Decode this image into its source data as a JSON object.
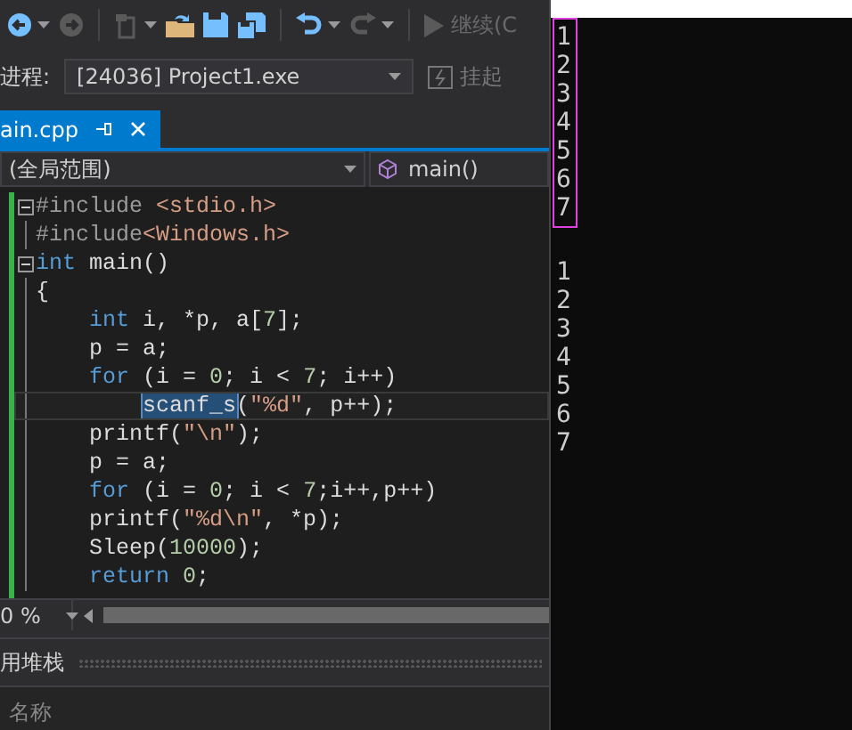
{
  "toolbar": [
    {
      "kind": "back",
      "disabled": false,
      "dropdown": true
    },
    {
      "kind": "forward",
      "disabled": true,
      "dropdown": false
    },
    {
      "kind": "new",
      "disabled": true,
      "dropdown": true
    },
    {
      "kind": "open",
      "disabled": false,
      "dropdown": false
    },
    {
      "kind": "save",
      "disabled": false,
      "dropdown": false
    },
    {
      "kind": "save-all",
      "disabled": false,
      "dropdown": false
    },
    {
      "kind": "undo",
      "disabled": false,
      "dropdown": true
    },
    {
      "kind": "redo",
      "disabled": true,
      "dropdown": true
    },
    {
      "kind": "continue",
      "disabled": true,
      "dropdown": false,
      "label": "继续(C"
    }
  ],
  "process": {
    "label": "进程:",
    "value": "[24036] Project1.exe",
    "suspend": {
      "label": "挂起",
      "disabled": true
    }
  },
  "tabs": [
    {
      "label": "ain.cpp",
      "selected": true
    }
  ],
  "navigation": {
    "scope": "(全局范围)",
    "member": "main()"
  },
  "code": [
    {
      "collapsible": true,
      "current": false,
      "tokens": [
        {
          "kind": "directive",
          "text": "#include "
        },
        {
          "kind": "string",
          "text": "<stdio.h>"
        }
      ]
    },
    {
      "collapsible": false,
      "current": false,
      "tokens": [
        {
          "kind": "directive",
          "text": "#include"
        },
        {
          "kind": "string",
          "text": "<Windows.h>"
        }
      ]
    },
    {
      "collapsible": true,
      "current": false,
      "tokens": [
        {
          "kind": "keyword",
          "text": "int"
        },
        {
          "kind": "plain",
          "text": " main()"
        }
      ]
    },
    {
      "collapsible": false,
      "current": false,
      "tokens": [
        {
          "kind": "plain",
          "text": "{"
        }
      ]
    },
    {
      "collapsible": false,
      "current": false,
      "tokens": [
        {
          "kind": "keyword",
          "text": "    int"
        },
        {
          "kind": "plain",
          "text": " i, *p, a["
        },
        {
          "kind": "number",
          "text": "7"
        },
        {
          "kind": "plain",
          "text": "];"
        }
      ]
    },
    {
      "collapsible": false,
      "current": false,
      "tokens": [
        {
          "kind": "plain",
          "text": "    p = a;"
        }
      ]
    },
    {
      "collapsible": false,
      "current": false,
      "tokens": [
        {
          "kind": "keyword",
          "text": "    for"
        },
        {
          "kind": "plain",
          "text": " (i = "
        },
        {
          "kind": "number",
          "text": "0"
        },
        {
          "kind": "plain",
          "text": "; i < "
        },
        {
          "kind": "number",
          "text": "7"
        },
        {
          "kind": "plain",
          "text": "; i++)"
        }
      ]
    },
    {
      "collapsible": false,
      "current": true,
      "tokens": [
        {
          "kind": "selection",
          "text": "        scanf_s"
        },
        {
          "kind": "plain",
          "text": "("
        },
        {
          "kind": "string",
          "text": "\"%d\""
        },
        {
          "kind": "plain",
          "text": ", p++);"
        }
      ]
    },
    {
      "collapsible": false,
      "current": false,
      "tokens": [
        {
          "kind": "plain",
          "text": "    printf("
        },
        {
          "kind": "string",
          "text": "\"\\n\""
        },
        {
          "kind": "plain",
          "text": ");"
        }
      ]
    },
    {
      "collapsible": false,
      "current": false,
      "tokens": [
        {
          "kind": "plain",
          "text": "    p = a;"
        }
      ]
    },
    {
      "collapsible": false,
      "current": false,
      "tokens": [
        {
          "kind": "keyword",
          "text": "    for"
        },
        {
          "kind": "plain",
          "text": " (i = "
        },
        {
          "kind": "number",
          "text": "0"
        },
        {
          "kind": "plain",
          "text": "; i < "
        },
        {
          "kind": "number",
          "text": "7"
        },
        {
          "kind": "plain",
          "text": ";i++,p++)"
        }
      ]
    },
    {
      "collapsible": false,
      "current": false,
      "tokens": [
        {
          "kind": "plain",
          "text": "    printf("
        },
        {
          "kind": "string",
          "text": "\"%d\\n\""
        },
        {
          "kind": "plain",
          "text": ", *p);"
        }
      ]
    },
    {
      "collapsible": false,
      "current": false,
      "tokens": [
        {
          "kind": "plain",
          "text": "    Sleep("
        },
        {
          "kind": "number",
          "text": "10000"
        },
        {
          "kind": "plain",
          "text": ");"
        }
      ]
    },
    {
      "collapsible": false,
      "current": false,
      "tokens": [
        {
          "kind": "keyword",
          "text": "    return "
        },
        {
          "kind": "number",
          "text": "0"
        },
        {
          "kind": "plain",
          "text": ";"
        }
      ]
    }
  ],
  "zoom": "0 %",
  "call_stack": {
    "title": "用堆栈",
    "columns": [
      "名称"
    ]
  },
  "console": {
    "blocks": [
      {
        "highlighted": true,
        "lines": [
          "1",
          "2",
          "3",
          "4",
          "5",
          "6",
          "7"
        ]
      },
      {
        "highlighted": false,
        "lines": [
          "1",
          "2",
          "3",
          "4",
          "5",
          "6",
          "7"
        ]
      }
    ]
  }
}
